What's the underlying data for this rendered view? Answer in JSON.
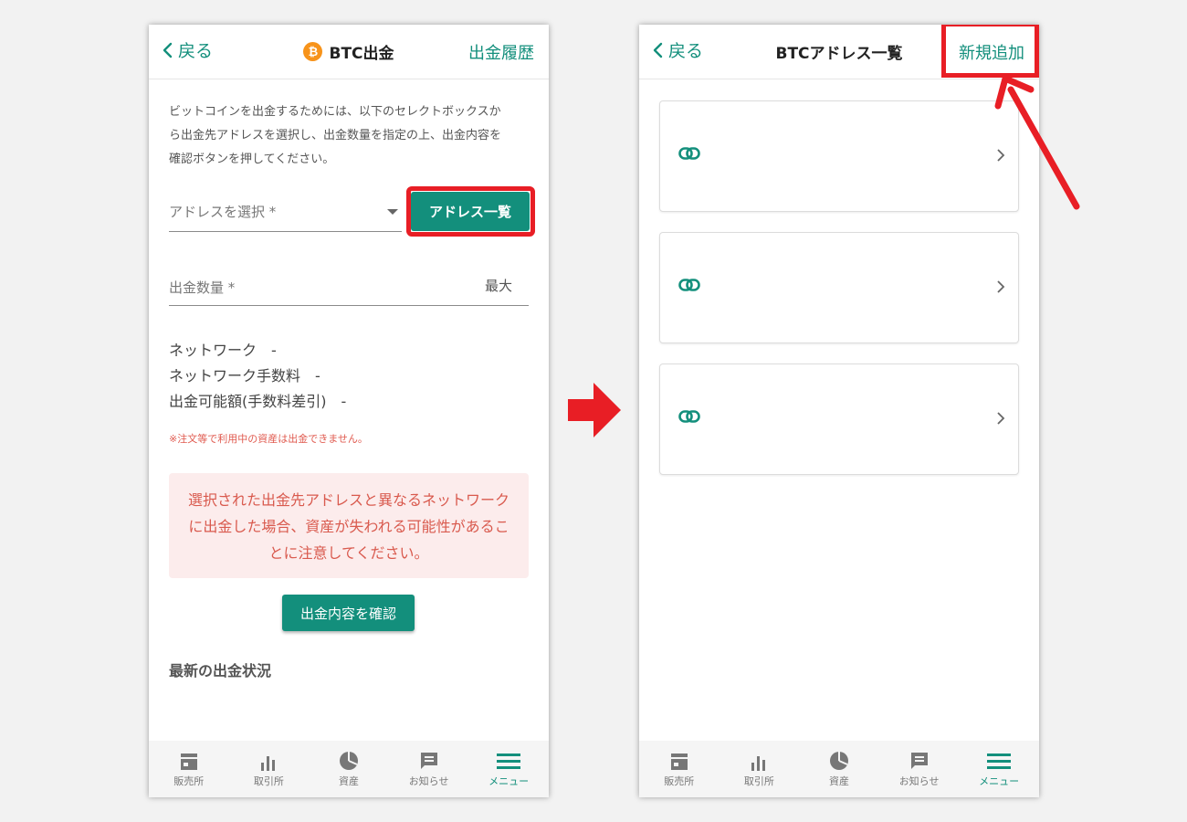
{
  "colors": {
    "accent": "#138f7c",
    "highlight": "#e81e25",
    "warning_text": "#d95a4e",
    "warning_bg": "#fcecec",
    "btc_orange": "#f7931a"
  },
  "left": {
    "back_label": "戻る",
    "title": "BTC出金",
    "coin_icon_glyph": "₿",
    "history_link": "出金履歴",
    "intro_lines": [
      "ビットコインを出金するためには、以下のセレクトボックスか",
      "ら出金先アドレスを選択し、出金数量を指定の上、出金内容を",
      "確認ボタンを押してください。"
    ],
    "address_placeholder": "アドレスを選択 *",
    "address_list_button": "アドレス一覧",
    "quantity_placeholder": "出金数量 *",
    "max_label": "最大",
    "network_line": "ネットワーク　-",
    "network_fee_line": "ネットワーク手数料　-",
    "available_line": "出金可能額(手数料差引)　-",
    "note": "※注文等で利用中の資産は出金できません。",
    "warning_lines": [
      "選択された出金先アドレスと異なるネットワーク",
      "に出金した場合、資産が失われる可能性があるこ",
      "とに注意してください。"
    ],
    "confirm_button": "出金内容を確認",
    "recent_status_title": "最新の出金状況"
  },
  "right": {
    "back_label": "戻る",
    "title": "BTCアドレス一覧",
    "add_new_label": "新規追加",
    "address_cards": [
      {
        "icon": "link-icon"
      },
      {
        "icon": "link-icon"
      },
      {
        "icon": "link-icon"
      }
    ]
  },
  "tabbar": {
    "shop": "販売所",
    "exchange": "取引所",
    "assets": "資産",
    "news": "お知らせ",
    "menu": "メニュー"
  }
}
